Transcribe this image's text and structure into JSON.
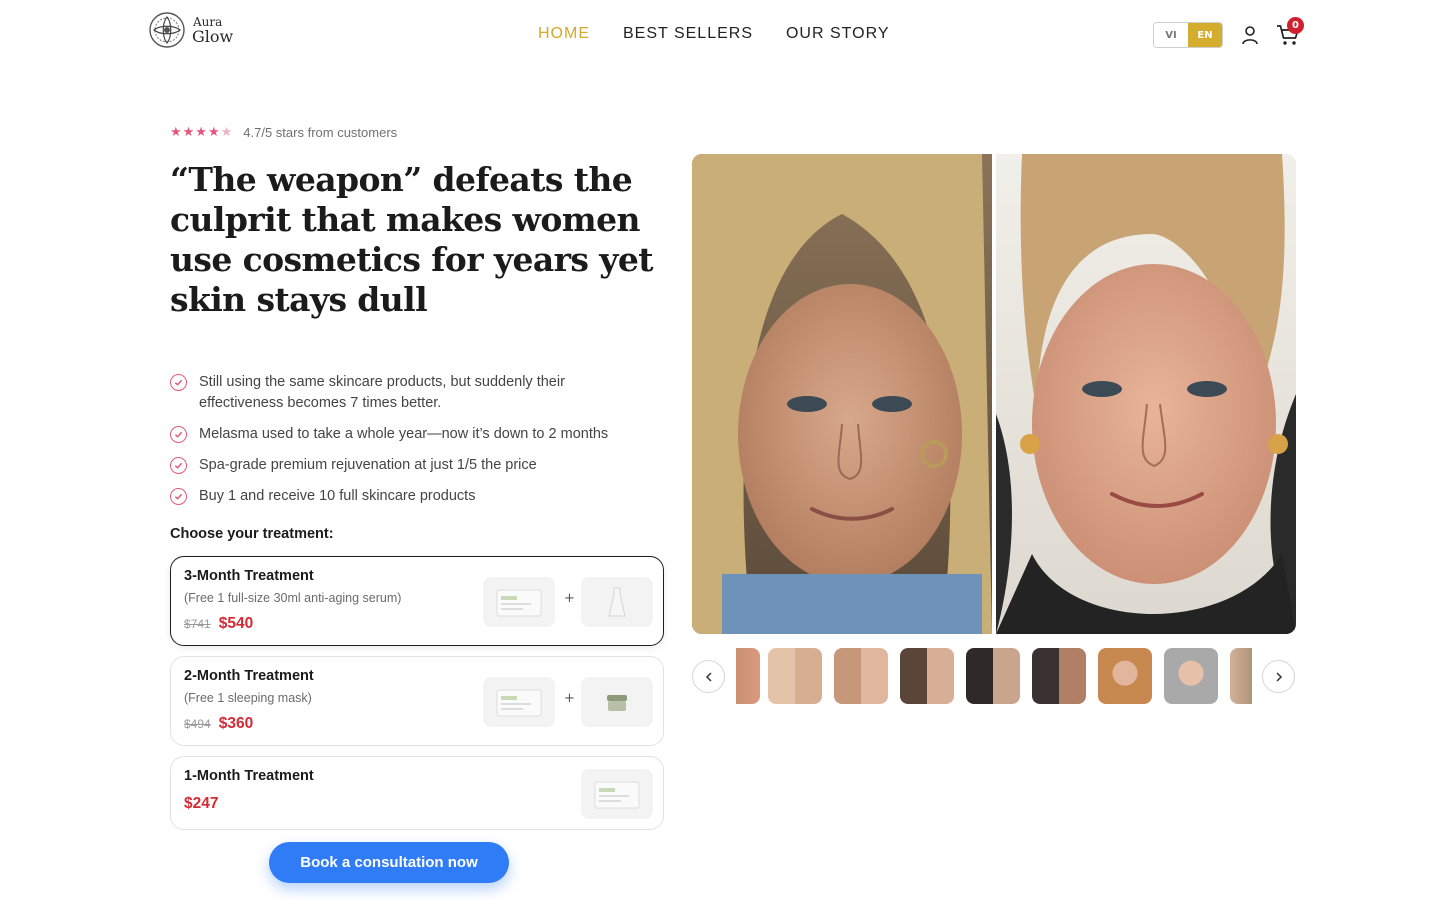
{
  "header": {
    "logo": {
      "line1": "Aura",
      "line2": "Glow"
    },
    "nav": [
      {
        "label": "HOME",
        "active": true
      },
      {
        "label": "BEST SELLERS",
        "active": false
      },
      {
        "label": "OUR STORY",
        "active": false
      }
    ],
    "languages": {
      "vi": "VI",
      "en": "EN",
      "selected": "EN"
    },
    "cart_count": "0",
    "icons": [
      "user-icon",
      "cart-icon"
    ]
  },
  "hero": {
    "rating": {
      "stars": 4.7,
      "max": 5,
      "text": "4.7/5 stars from customers"
    },
    "headline": "“The weapon” defeats the culprit that makes women use cosmetics for years yet skin stays dull",
    "benefits": [
      "Still using the same skincare products, but suddenly their effectiveness becomes 7 times better.",
      "Melasma used to take a whole year—now it’s down to 2 months",
      "Spa-grade premium rejuvenation at just 1/5 the price",
      "Buy 1 and receive 10 full skincare products"
    ],
    "choose_label": "Choose your treatment:",
    "options": [
      {
        "title": "3-Month Treatment",
        "subtitle": "(Free 1 full-size 30ml anti-aging serum)",
        "old_price": "$741",
        "price": "$540",
        "selected": true
      },
      {
        "title": "2-Month Treatment",
        "subtitle": "(Free 1 sleeping mask)",
        "old_price": "$494",
        "price": "$360",
        "selected": false
      },
      {
        "title": "1-Month Treatment",
        "subtitle": "",
        "old_price": "",
        "price": "$247",
        "selected": false
      }
    ],
    "plus": "+",
    "cta": "Book a consultation now"
  },
  "gallery": {
    "thumbnail_count": 9,
    "selected_index": 0
  },
  "colors": {
    "accent_gold": "#d4a82b",
    "cta_blue": "#2f7cf6",
    "price_red": "#d42a34",
    "check_pink": "#e05a78",
    "badge_red": "#d01f2f"
  }
}
